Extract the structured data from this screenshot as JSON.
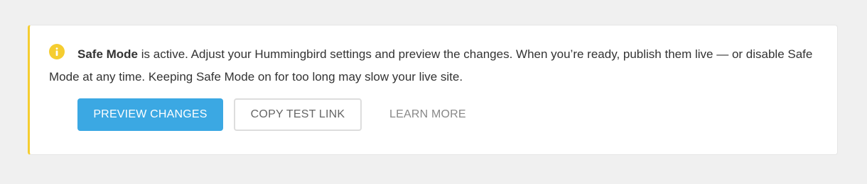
{
  "notice": {
    "type": "warning",
    "accent_color": "#f5cd30",
    "icon": "info-icon",
    "title": "Safe Mode",
    "message": " is active. Adjust your Hummingbird settings and preview the changes. When you’re ready, publish them live — or disable Safe Mode at any time. Keeping Safe Mode on for too long may slow your live site."
  },
  "actions": {
    "preview_label": "PREVIEW CHANGES",
    "preview_color": "#3ba8e3",
    "copy_label": "COPY TEST LINK",
    "learn_label": "LEARN MORE"
  }
}
